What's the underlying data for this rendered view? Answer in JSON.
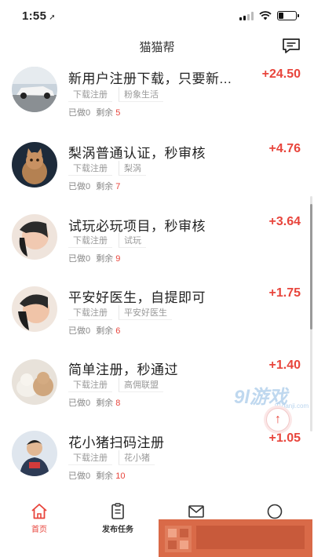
{
  "status": {
    "time": "1:55",
    "location_arrow": "➚"
  },
  "nav": {
    "title": "猫猫帮",
    "message_icon": "message-icon"
  },
  "tasks": [
    {
      "title": "新用户注册下载，只要新...",
      "reward": "+24.50",
      "tags": [
        "下载注册",
        "粉象生活"
      ],
      "done_label": "已做",
      "done": "0",
      "remain_label": "剩余",
      "remain": "5"
    },
    {
      "title": "梨涡普通认证，秒审核",
      "reward": "+4.76",
      "tags": [
        "下载注册",
        "梨涡"
      ],
      "done_label": "已做",
      "done": "0",
      "remain_label": "剩余",
      "remain": "7"
    },
    {
      "title": "试玩必玩项目，秒审核",
      "reward": "+3.64",
      "tags": [
        "下载注册",
        "试玩"
      ],
      "done_label": "已做",
      "done": "0",
      "remain_label": "剩余",
      "remain": "9"
    },
    {
      "title": "平安好医生，自提即可",
      "reward": "+1.75",
      "tags": [
        "下载注册",
        "平安好医生"
      ],
      "done_label": "已做",
      "done": "0",
      "remain_label": "剩余",
      "remain": "6"
    },
    {
      "title": "简单注册，秒通过",
      "reward": "+1.40",
      "tags": [
        "下载注册",
        "高佣联盟"
      ],
      "done_label": "已做",
      "done": "0",
      "remain_label": "剩余",
      "remain": "8"
    },
    {
      "title": "花小猪扫码注册",
      "reward": "+1.05",
      "tags": [
        "下载注册",
        "花小猪"
      ],
      "done_label": "已做",
      "done": "0",
      "remain_label": "剩余",
      "remain": "10"
    }
  ],
  "watermark": {
    "brand": "9l游戏",
    "domain": "91danji.com"
  },
  "back_to_top_glyph": "↑",
  "tabbar": {
    "items": [
      {
        "label": "首页",
        "icon": "home-icon",
        "active": true
      },
      {
        "label": "发布任务",
        "icon": "publish-task-icon",
        "active": false
      },
      {
        "label": "",
        "icon": "mail-icon",
        "active": false
      },
      {
        "label": "",
        "icon": "chat-icon",
        "active": false
      }
    ]
  },
  "colors": {
    "accent": "#e8453c",
    "muted_text": "#888888",
    "ad_banner": "#d96a48"
  }
}
